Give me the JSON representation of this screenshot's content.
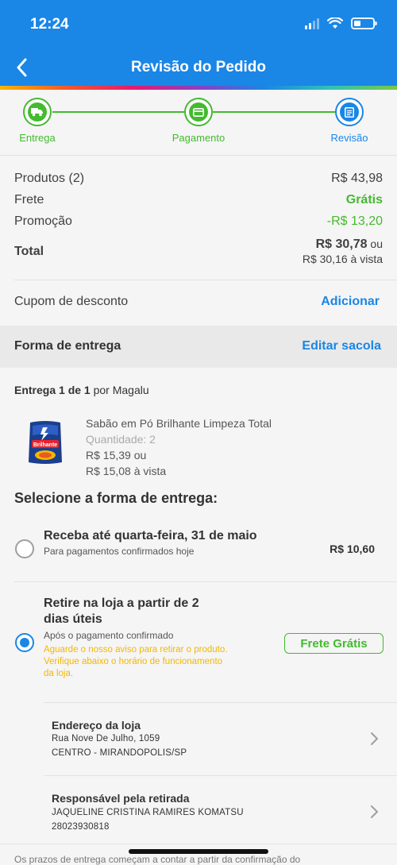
{
  "status_bar": {
    "time": "12:24"
  },
  "header": {
    "title": "Revisão do Pedido"
  },
  "steps": [
    {
      "label": "Entrega"
    },
    {
      "label": "Pagamento"
    },
    {
      "label": "Revisão"
    }
  ],
  "summary": {
    "products_label": "Produtos (2)",
    "products_value": "R$ 43,98",
    "shipping_label": "Frete",
    "shipping_value": "Grátis",
    "promo_label": "Promoção",
    "promo_value": "-R$ 13,20",
    "total_label": "Total",
    "total_value": "R$ 30,78",
    "total_or": " ou",
    "total_cash": "R$ 30,16 à vista"
  },
  "coupon": {
    "label": "Cupom de desconto",
    "action": "Adicionar"
  },
  "delivery_section": {
    "title": "Forma de entrega",
    "action": "Editar sacola"
  },
  "shipment": {
    "count_label": "Entrega 1 de 1",
    "seller": " por Magalu"
  },
  "product": {
    "name": "Sabão em Pó Brilhante Limpeza Total",
    "quantity": "Quantidade: 2",
    "price": "R$ 15,39 ou",
    "cash_price": "R$ 15,08 à vista",
    "brand_mark": "Brilhante"
  },
  "select_title": "Selecione a forma de entrega:",
  "options": [
    {
      "title": "Receba até quarta-feira, 31 de maio",
      "subtitle": "Para pagamentos confirmados hoje",
      "price": "R$ 10,60",
      "selected": false
    },
    {
      "title_line1": "Retire na loja a partir de 2",
      "title_line2": "dias úteis",
      "subtitle": "Após o pagamento confirmado",
      "warning_line1": "Aguarde o nosso aviso para retirar o produto.",
      "warning_line2": "Verifique abaixo o horário de funcionamento",
      "warning_line3": "da loja.",
      "badge": "Frete Grátis",
      "selected": true
    }
  ],
  "store": {
    "title": "Endereço da loja",
    "line1": "Rua Nove De Julho, 1059",
    "line2": "CENTRO - MIRANDOPOLIS/SP"
  },
  "pickup": {
    "title": "Responsável pela retirada",
    "name": "JAQUELINE CRISTINA RAMIRES KOMATSU",
    "doc": "28023930818"
  },
  "footer": {
    "text": "Os prazos de entrega começam a contar a partir da confirmação do"
  },
  "colors": {
    "primary": "#1a86e6",
    "green": "#44ba2f",
    "warning": "#f5b700"
  }
}
